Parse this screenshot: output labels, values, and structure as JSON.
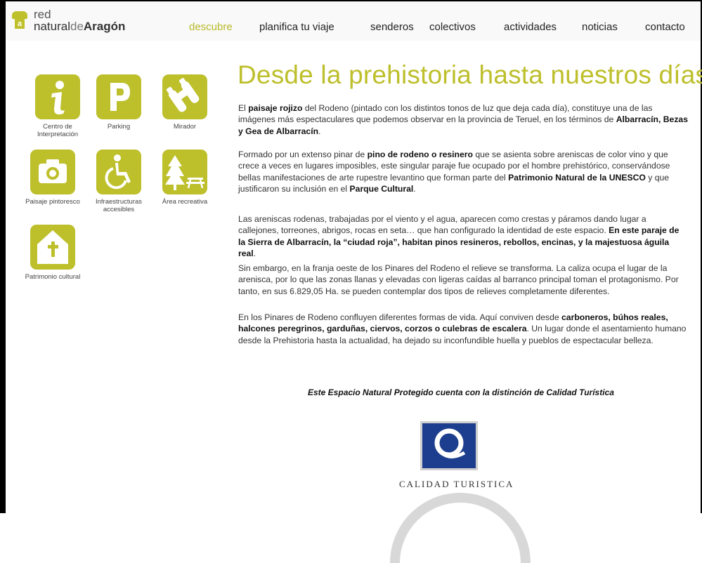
{
  "header": {
    "logo_top": "red",
    "logo_bottom_a": "natural",
    "logo_bottom_b": "de",
    "logo_bottom_c": "Aragón",
    "logo_badge": "a"
  },
  "nav": {
    "items": [
      {
        "label": "descubre",
        "active": true
      },
      {
        "label": "planifica tu viaje"
      },
      {
        "label": "senderos"
      },
      {
        "label": "colectivos"
      },
      {
        "label": "actividades"
      },
      {
        "label": "noticias"
      },
      {
        "label": "contacto"
      }
    ],
    "accent_color": "#b8b92a"
  },
  "services": [
    {
      "label": "Centro de Interpretación",
      "icon": "info-icon"
    },
    {
      "label": "Parking",
      "icon": "parking-icon"
    },
    {
      "label": "Mirador",
      "icon": "binoculars-icon"
    },
    {
      "label": "Paisaje pintoresco",
      "icon": "camera-icon"
    },
    {
      "label": "Infraestructuras accesibles",
      "icon": "wheelchair-icon"
    },
    {
      "label": "Área recreativa",
      "icon": "tree-picnic-icon"
    },
    {
      "label": "Patrimonio cultural",
      "icon": "church-icon"
    }
  ],
  "content": {
    "title": "Desde la prehistoria hasta nuestros días",
    "p1_a": "El ",
    "p1_b": "paisaje rojizo",
    "p1_c": " del Rodeno (pintado con los distintos tonos de luz que deja cada día), constituye una de las imágenes más espectaculares que podemos observar en la provincia de Teruel, en los términos de ",
    "p1_d": "Albarracín, Bezas y Gea de Albarracín",
    "p1_e": ".",
    "p2_a": "Formado por un extenso pinar de ",
    "p2_b": "pino de rodeno o resinero",
    "p2_c": " que se asienta sobre areniscas de color vino y que crece a veces en lugares imposibles, este singular paraje fue ocupado por el hombre prehistórico, conservándose bellas manifestaciones de arte rupestre levantino que forman parte del ",
    "p2_d": "Patrimonio Natural de la UNESCO",
    "p2_e": " y que justificaron su inclusión en el ",
    "p2_f": "Parque Cultural",
    "p2_g": ".",
    "p3_a": "Las areniscas rodenas, trabajadas por el viento y el agua, aparecen como crestas y páramos dando lugar a callejones, torreones, abrigos, rocas en seta… que han configurado la identidad de este espacio. ",
    "p3_b": "En este paraje de la Sierra de Albarracín, la “ciudad roja”, habitan pinos resineros, rebollos, encinas, y la majestuosa águila real",
    "p3_c": ".",
    "p4": "Sin embargo, en la franja oeste de los Pinares del Rodeno el relieve se transforma. La caliza ocupa el lugar de la arenisca, por lo que las zonas llanas y elevadas con ligeras caídas al barranco principal toman el protagonismo. Por tanto, en sus 6.829,05 Ha. se pueden contemplar dos tipos de relieves completamente diferentes.",
    "p5_a": "En los Pinares de Rodeno confluyen diferentes formas de vida. Aquí conviven desde ",
    "p5_b": "carboneros, búhos reales, halcones peregrinos, garduñas, ciervos, corzos o culebras de escalera",
    "p5_c": ". Un lugar donde el asentamiento humano desde la Prehistoria hasta la actualidad, ha dejado su inconfundible huella y pueblos de espectacular belleza.",
    "quality_note": "Este Espacio Natural Protegido cuenta con la distinción de Calidad Turística",
    "quality_caption": "CALIDAD TURISTICA"
  },
  "colors": {
    "accent": "#bdbf2b",
    "quality_blue": "#1d3e8e"
  }
}
